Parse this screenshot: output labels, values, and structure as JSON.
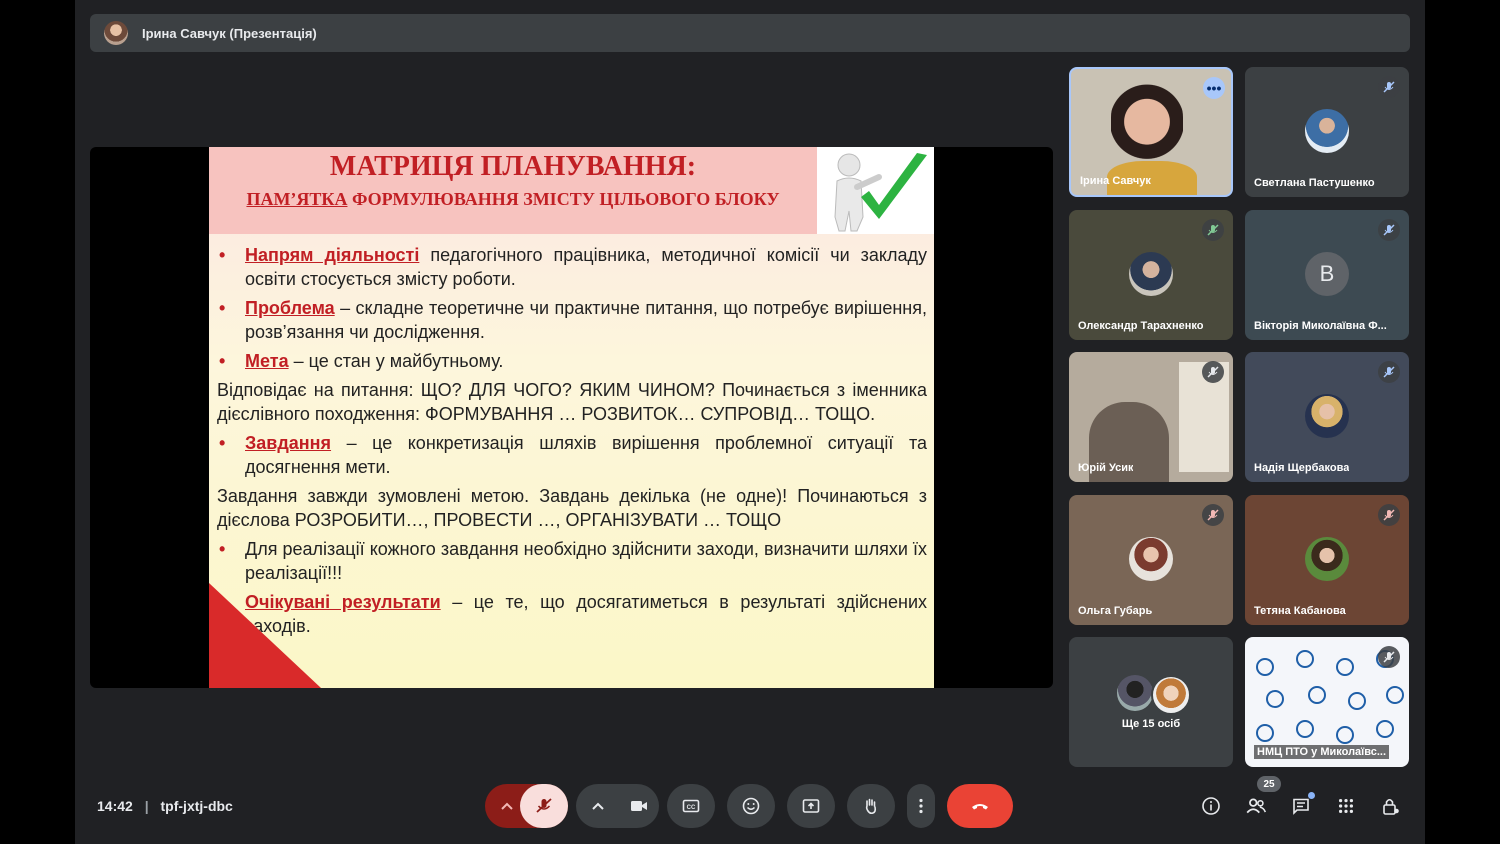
{
  "header": {
    "presenter_label": "Ірина Савчук (Презентація)"
  },
  "slide": {
    "title_line1": "МАТРИЦЯ ПЛАНУВАННЯ:",
    "title_line2_underlined": "ПАМ’ЯТКА",
    "title_line2_rest": " ФОРМУЛЮВАННЯ ЗМІСТУ ЦІЛЬОВОГО БЛОКУ",
    "b1_kw": "Напрям діяльності",
    "b1_text": " педагогічного працівника, методичної комісії чи закладу освіти стосується змісту роботи.",
    "b2_kw": "Проблема",
    "b2_text": " – складне теоретичне чи практичне питання, що потребує вирішення, розв’язання чи дослідження.",
    "b3_kw": "Мета",
    "b3_text": " – це стан у майбутньому.",
    "p1": "Відповідає на питання: ЩО? ДЛЯ ЧОГО? ЯКИМ ЧИНОМ? Починається з іменника дієслівного походження: ФОРМУВАННЯ … РОЗВИТОК… СУПРОВІД… ТОЩО.",
    "b4_kw": "Завдання",
    "b4_text": " – це конкретизація шляхів вирішення проблемної ситуації та досягнення мети.",
    "p2": "Завдання завжди зумовлені метою. Завдань декілька (не одне)! Починаються з дієслова РОЗРОБИТИ…, ПРОВЕСТИ …, ОРГАНІЗУВАТИ … ТОЩО",
    "b5_text": "Для реалізації кожного завдання необхідно здійснити заходи, визначити шляхи їх реалізації!!!",
    "b6_kw": "Очікувані результати",
    "b6_text": " – це те, що досягатиметься в результаті здійснених заходів."
  },
  "participants": [
    {
      "name": "Ірина Савчук"
    },
    {
      "name": "Светлана Пастушенко"
    },
    {
      "name": "Олександр Тарахненко"
    },
    {
      "name": "Вікторія Миколаївна Ф...",
      "initial": "В"
    },
    {
      "name": "Юрій Усик"
    },
    {
      "name": "Надія Щербакова"
    },
    {
      "name": "Ольга Губарь"
    },
    {
      "name": "Тетяна Кабанова"
    },
    {
      "name": "Ще 15 осіб"
    },
    {
      "name": "НМЦ ПТО у Миколаївс..."
    }
  ],
  "bottom_bar": {
    "time": "14:42",
    "separator": "|",
    "meeting_code": "tpf-jxtj-dbc",
    "people_count": "25"
  },
  "colors": {
    "end_call": "#ea4335",
    "mic_off_bg": "#f9dedc",
    "slide_red": "#c11f24"
  }
}
